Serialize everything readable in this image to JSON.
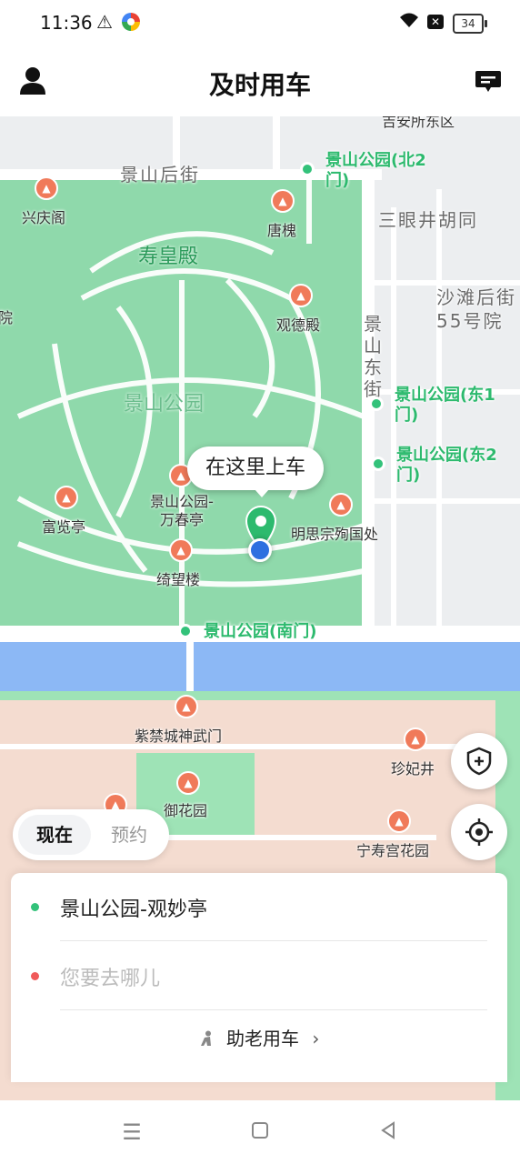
{
  "status_bar": {
    "time": "11:36",
    "battery": "34"
  },
  "header": {
    "title": "及时用车"
  },
  "map": {
    "street_labels": [
      "景山后街",
      "三眼井胡同",
      "景山东街",
      "沙滩后街55号院"
    ],
    "park_name": "寿皇殿",
    "park_area_label": "景山公园",
    "pois": [
      "兴庆阁",
      "唐槐",
      "观德殿",
      "富览亭",
      "景山公园-万春亭",
      "绮望楼",
      "明思宗殉国处",
      "紫禁城神武门",
      "珍妃井",
      "御花园",
      "宁寿宫花园"
    ],
    "gates": [
      "景山公园(北2门)",
      "景山公园(东1门)",
      "景山公园(东2门)",
      "景山公园(南门)"
    ],
    "pickup_bubble": "在这里上车",
    "top_partial": "吉安所东区",
    "left_partial": "院"
  },
  "mode_tabs": {
    "now": "现在",
    "reserve": "预约"
  },
  "route": {
    "from": "景山公园-观妙亭",
    "to_placeholder": "您要去哪儿",
    "elder_link": "助老用车"
  }
}
